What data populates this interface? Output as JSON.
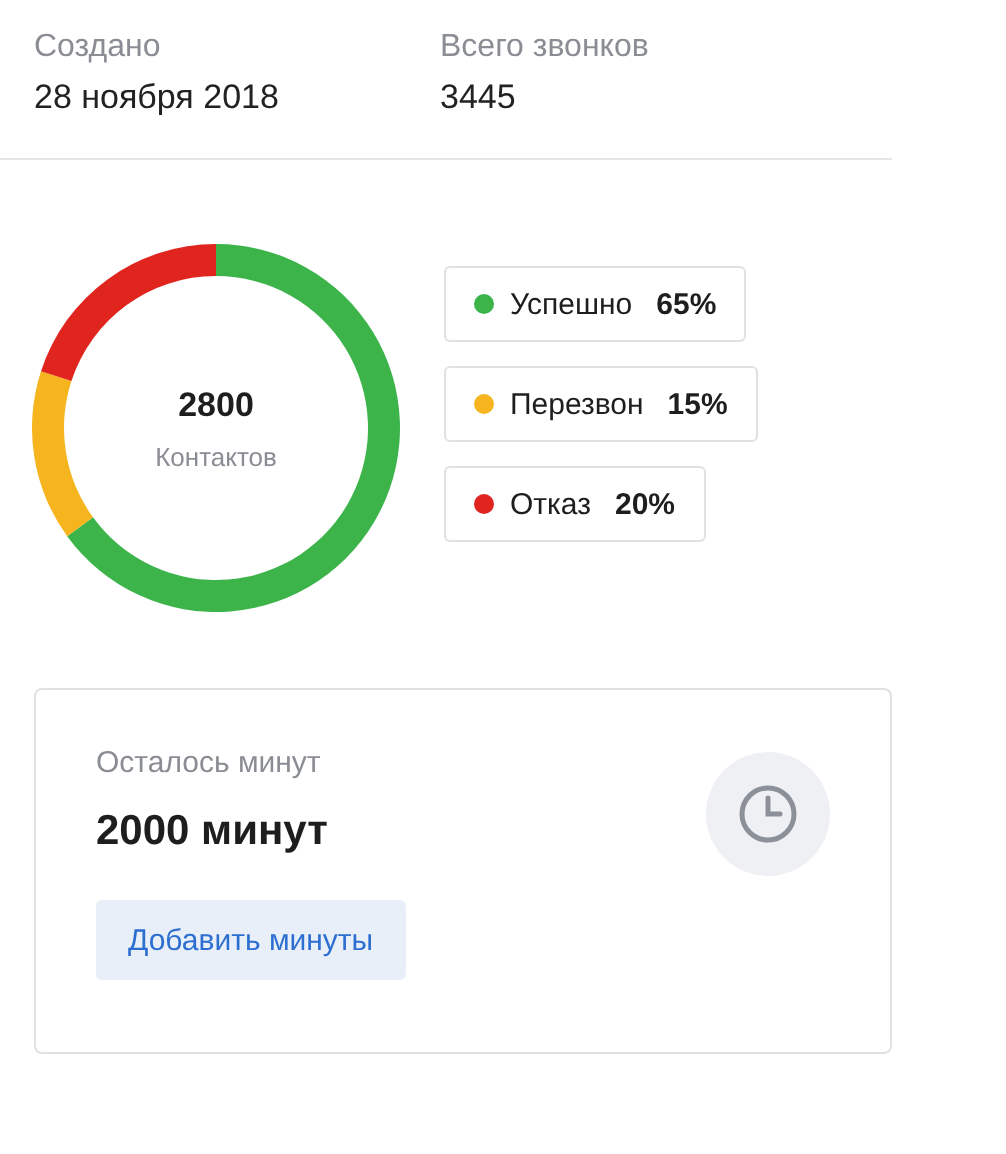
{
  "stats": [
    {
      "label": "Создано",
      "value": "28 ноября 2018"
    },
    {
      "label": "Всего звонков",
      "value": "3445"
    }
  ],
  "donut": {
    "total": "2800",
    "caption": "Контактов",
    "chart_data": {
      "type": "donut",
      "categories": [
        "Успешно",
        "Перезвон",
        "Отказ"
      ],
      "values": [
        65,
        15,
        20
      ]
    }
  },
  "legend": [
    {
      "percent": "65%",
      "color": "#3cb44a"
    },
    {
      "percent": "15%",
      "color": "#f6b51e"
    },
    {
      "percent": "20%",
      "color": "#e0251f"
    }
  ],
  "minutes": {
    "label": "Осталось минут",
    "value": "2000 минут",
    "button": "Добавить минуты"
  }
}
